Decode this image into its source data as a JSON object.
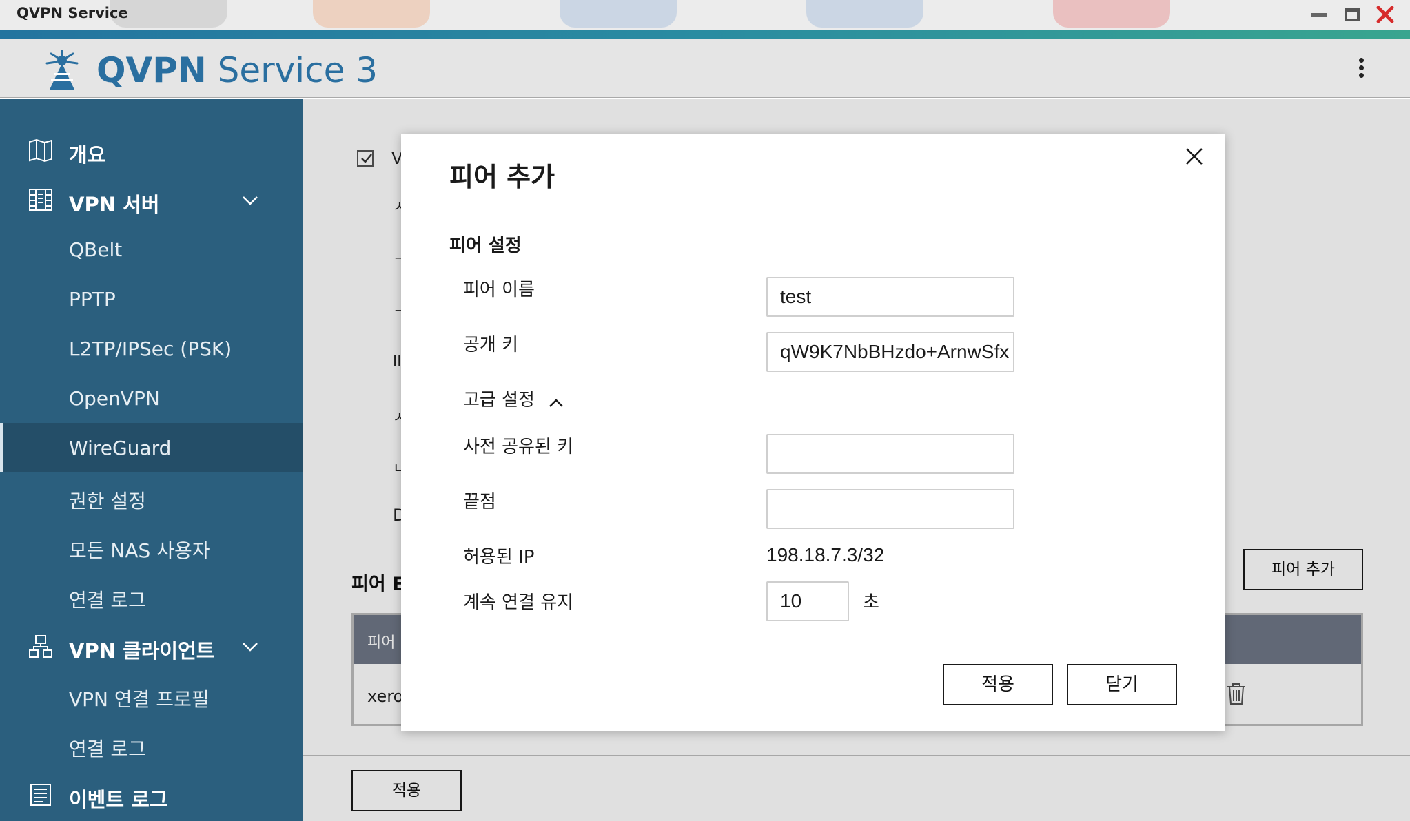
{
  "window": {
    "title": "QVPN Service",
    "controls": [
      "minimize-icon",
      "maximize-icon",
      "close-icon"
    ],
    "close_color": "#d62c2c"
  },
  "header": {
    "brand": "QVPN",
    "product": "Service 3",
    "brand_color": "#2a6fa0",
    "menu_icon": "kebab-menu-icon"
  },
  "sidebar": {
    "bg_color": "#2b5f7e",
    "items": [
      {
        "label": "개요",
        "icon": "book-icon",
        "level": "top"
      },
      {
        "label": "VPN 서버",
        "icon": "server-icon",
        "level": "top",
        "expanded": true
      },
      {
        "label": "QBelt",
        "level": "sub"
      },
      {
        "label": "PPTP",
        "level": "sub"
      },
      {
        "label": "L2TP/IPSec (PSK)",
        "level": "sub"
      },
      {
        "label": "OpenVPN",
        "level": "sub"
      },
      {
        "label": "WireGuard",
        "level": "sub",
        "active": true
      },
      {
        "label": "권한 설정",
        "level": "sub"
      },
      {
        "label": "모든 NAS 사용자",
        "level": "sub"
      },
      {
        "label": "연결 로그",
        "level": "sub"
      },
      {
        "label": "VPN 클라이언트",
        "icon": "network-icon",
        "level": "top",
        "expanded": true
      },
      {
        "label": "VPN 연결 프로필",
        "level": "sub"
      },
      {
        "label": "연결 로그",
        "level": "sub"
      },
      {
        "label": "이벤트 로그",
        "icon": "log-icon",
        "level": "top"
      }
    ]
  },
  "background": {
    "checkbox_fragment": "V",
    "row_fragments": [
      "ㅅ",
      "ㄱ",
      "ㄱ",
      "II",
      "ㅅ",
      "ㄴ",
      "D"
    ],
    "peer_table_title": "피어 E",
    "add_peer_button": "피어 추가",
    "table_header_first": "피어",
    "table_row_first": "xero",
    "apply_button": "적용"
  },
  "modal": {
    "title": "피어 추가",
    "section_title": "피어 설정",
    "fields": {
      "peer_name": {
        "label": "피어 이름",
        "value": "test"
      },
      "public_key": {
        "label": "공개 키",
        "value": "qW9K7NbBHzdo+ArnwSfx"
      },
      "advanced": {
        "label": "고급 설정",
        "expanded": true
      },
      "preshared_key": {
        "label": "사전 공유된 키",
        "value": ""
      },
      "endpoint": {
        "label": "끝점",
        "value": ""
      },
      "allowed_ip": {
        "label": "허용된 IP",
        "value": "198.18.7.3/32"
      },
      "keepalive": {
        "label": "계속 연결 유지",
        "value": "10",
        "unit": "초"
      }
    },
    "buttons": {
      "apply": "적용",
      "close": "닫기"
    }
  }
}
